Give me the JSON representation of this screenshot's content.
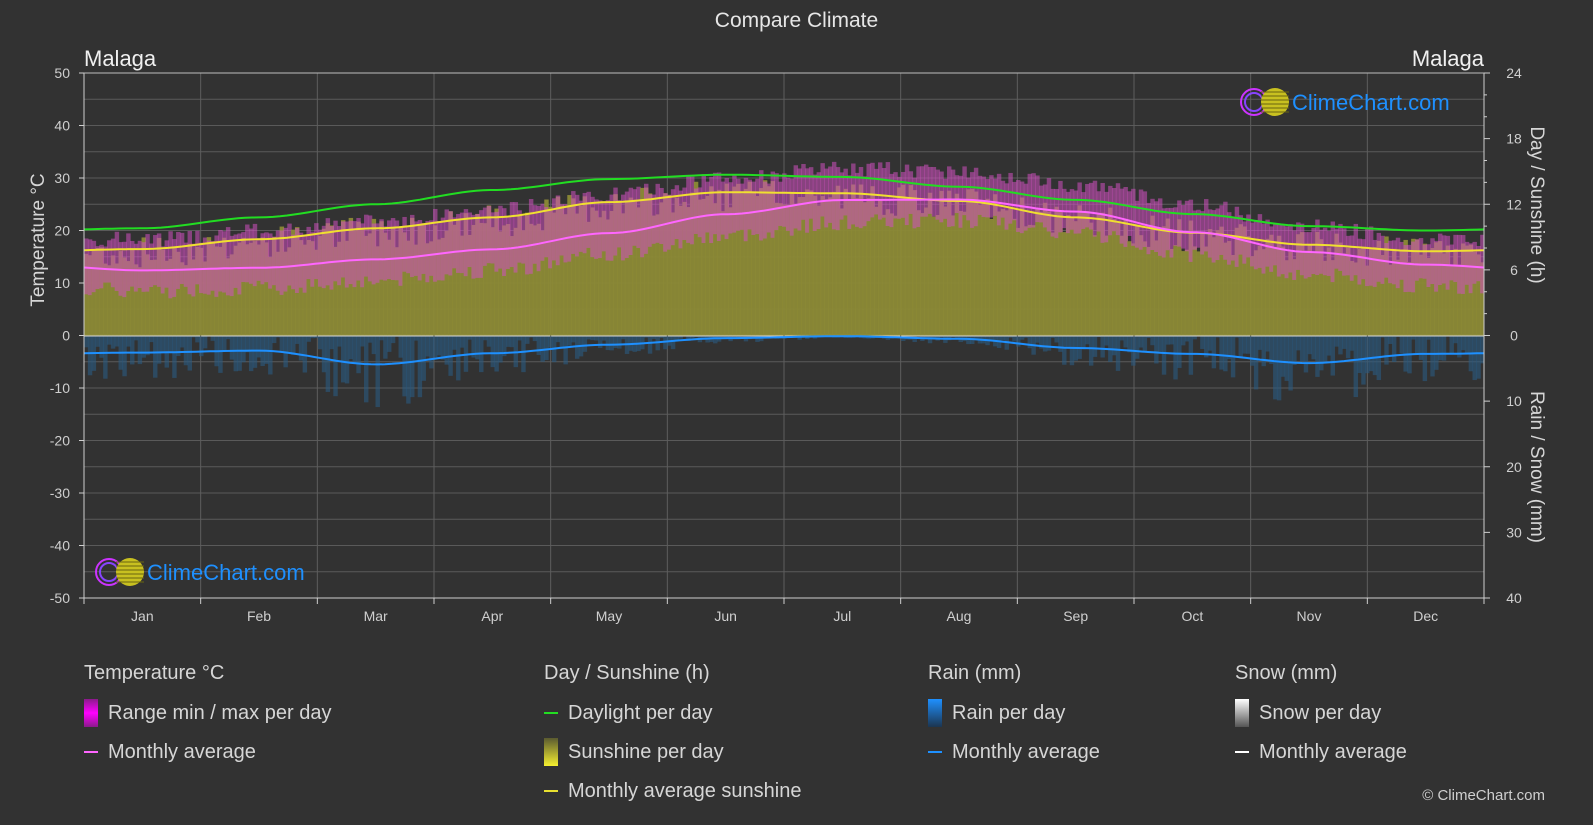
{
  "title": "Compare Climate",
  "city_left": "Malaga",
  "city_right": "Malaga",
  "watermark": "ClimeChart.com",
  "copyright": "© ClimeChart.com",
  "colors": {
    "background": "#323232",
    "temp_avg": "#ff66ff",
    "temp_range": "#cc33cc",
    "daylight": "#22dd22",
    "sunshine_avg": "#f0e030",
    "sunshine_fill": "#8c8a36",
    "rain_avg": "#1e90ff",
    "rain_bars": "#2a5a80",
    "watermark": "#1e90ff"
  },
  "legend": {
    "temperature": {
      "header": "Temperature °C",
      "range": "Range min / max per day",
      "avg": "Monthly average"
    },
    "sunshine": {
      "header": "Day / Sunshine (h)",
      "daylight": "Daylight per day",
      "sunshine": "Sunshine per day",
      "avg": "Monthly average sunshine"
    },
    "rain": {
      "header": "Rain (mm)",
      "per_day": "Rain per day",
      "avg": "Monthly average"
    },
    "snow": {
      "header": "Snow (mm)",
      "per_day": "Snow per day",
      "avg": "Monthly average"
    }
  },
  "chart_data": {
    "type": "line",
    "title": "Compare Climate",
    "categories": [
      "Jan",
      "Feb",
      "Mar",
      "Apr",
      "May",
      "Jun",
      "Jul",
      "Aug",
      "Sep",
      "Oct",
      "Nov",
      "Dec"
    ],
    "y_left": {
      "label": "Temperature °C",
      "range": [
        -50,
        50
      ],
      "ticks": [
        50,
        40,
        30,
        20,
        10,
        0,
        -10,
        -20,
        -30,
        -40,
        -50
      ]
    },
    "y_right_top": {
      "label": "Day / Sunshine (h)",
      "range": [
        0,
        24
      ],
      "ticks": [
        24,
        18,
        12,
        6,
        0
      ]
    },
    "y_right_bottom": {
      "label": "Rain / Snow (mm)",
      "range": [
        0,
        40
      ],
      "ticks": [
        0,
        10,
        20,
        30,
        40
      ]
    },
    "grid": true,
    "series": [
      {
        "name": "Temperature monthly average (°C)",
        "axis": "temp",
        "values": [
          12.4,
          12.9,
          14.5,
          16.4,
          19.5,
          23.1,
          25.8,
          25.9,
          23.6,
          19.7,
          15.9,
          13.5
        ]
      },
      {
        "name": "Temperature daily max avg (°C)",
        "axis": "temp",
        "values": [
          18.0,
          19.5,
          21.5,
          23.5,
          26.5,
          29.5,
          31.5,
          31.0,
          28.5,
          24.5,
          20.5,
          18.0
        ]
      },
      {
        "name": "Temperature daily min avg (°C)",
        "axis": "temp",
        "values": [
          8.5,
          9.0,
          10.5,
          12.5,
          15.5,
          19.0,
          21.5,
          22.0,
          19.5,
          15.5,
          11.5,
          9.5
        ]
      },
      {
        "name": "Daylight per day (h)",
        "axis": "sun",
        "values": [
          9.8,
          10.8,
          12.0,
          13.3,
          14.3,
          14.7,
          14.5,
          13.6,
          12.4,
          11.1,
          10.0,
          9.6
        ]
      },
      {
        "name": "Monthly average sunshine (h)",
        "axis": "sun",
        "values": [
          7.9,
          8.8,
          9.8,
          10.8,
          12.2,
          13.1,
          13.0,
          12.3,
          10.8,
          9.4,
          8.3,
          7.7
        ]
      },
      {
        "name": "Rain monthly average (mm/day)",
        "axis": "rain",
        "values": [
          2.6,
          2.3,
          4.4,
          2.7,
          1.4,
          0.4,
          0.1,
          0.5,
          1.9,
          2.8,
          4.2,
          2.8
        ]
      },
      {
        "name": "Snow monthly average (mm/day)",
        "axis": "rain",
        "values": [
          0,
          0,
          0,
          0,
          0,
          0,
          0,
          0,
          0,
          0,
          0,
          0
        ]
      }
    ]
  }
}
